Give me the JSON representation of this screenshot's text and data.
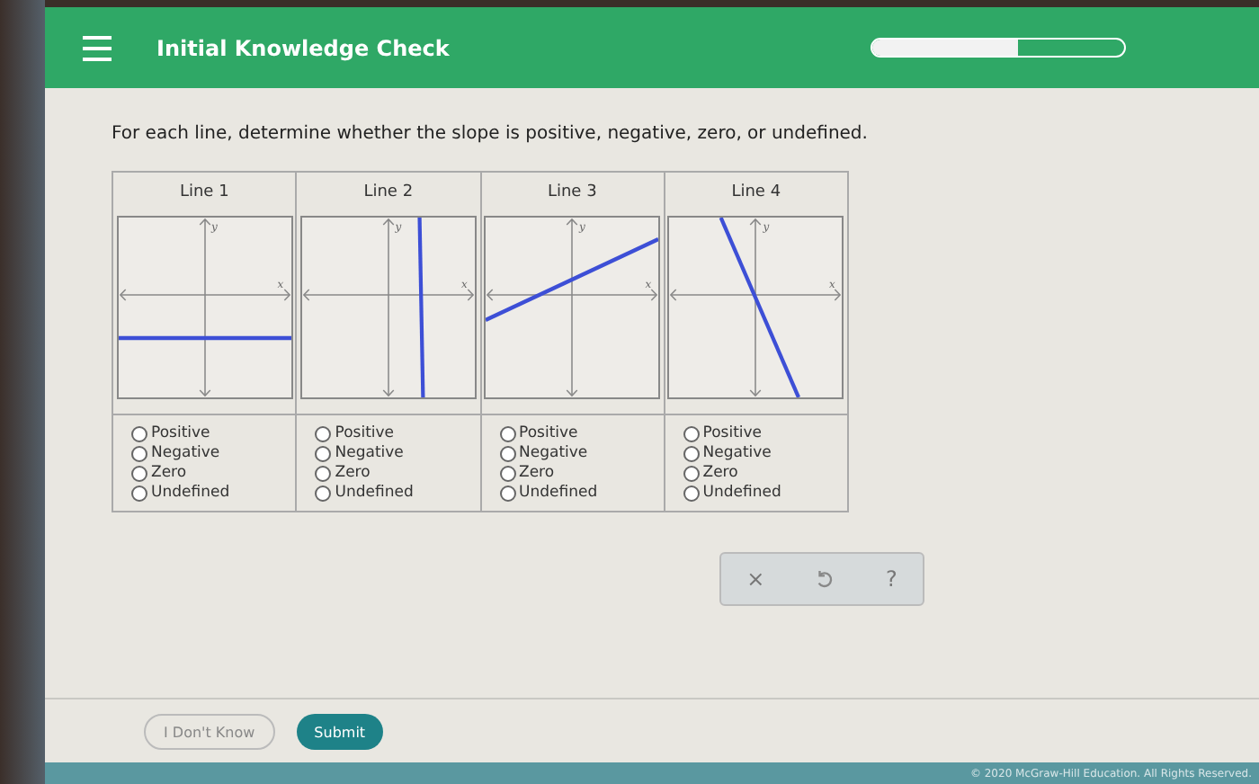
{
  "header": {
    "title": "Initial Knowledge Check",
    "progress": {
      "level": 0.58
    }
  },
  "prompt": "For each line, determine whether the slope is positive, negative, zero, or undefined.",
  "lines": [
    {
      "heading": "Line 1",
      "kind": "horizontal",
      "axis_x": "x",
      "axis_y": "y",
      "options": [
        {
          "label": "Positive",
          "selected": false
        },
        {
          "label": "Negative",
          "selected": false
        },
        {
          "label": "Zero",
          "selected": false
        },
        {
          "label": "Undefined",
          "selected": false
        }
      ]
    },
    {
      "heading": "Line 2",
      "kind": "vertical",
      "axis_x": "x",
      "axis_y": "y",
      "options": [
        {
          "label": "Positive",
          "selected": false
        },
        {
          "label": "Negative",
          "selected": false
        },
        {
          "label": "Zero",
          "selected": false
        },
        {
          "label": "Undefined",
          "selected": false
        }
      ]
    },
    {
      "heading": "Line 3",
      "kind": "rising",
      "axis_x": "x",
      "axis_y": "y",
      "options": [
        {
          "label": "Positive",
          "selected": false
        },
        {
          "label": "Negative",
          "selected": false
        },
        {
          "label": "Zero",
          "selected": false
        },
        {
          "label": "Undefined",
          "selected": false
        }
      ]
    },
    {
      "heading": "Line 4",
      "kind": "falling",
      "axis_x": "x",
      "axis_y": "y",
      "options": [
        {
          "label": "Positive",
          "selected": false
        },
        {
          "label": "Negative",
          "selected": false
        },
        {
          "label": "Zero",
          "selected": false
        },
        {
          "label": "Undefined",
          "selected": false
        }
      ]
    }
  ],
  "tools": [
    "×",
    "?"
  ],
  "buttons": {
    "dont_know": "I Don't Know",
    "submit": "Submit"
  },
  "footer": "© 2020 McGraw-Hill Education. All Rights Reserved."
}
